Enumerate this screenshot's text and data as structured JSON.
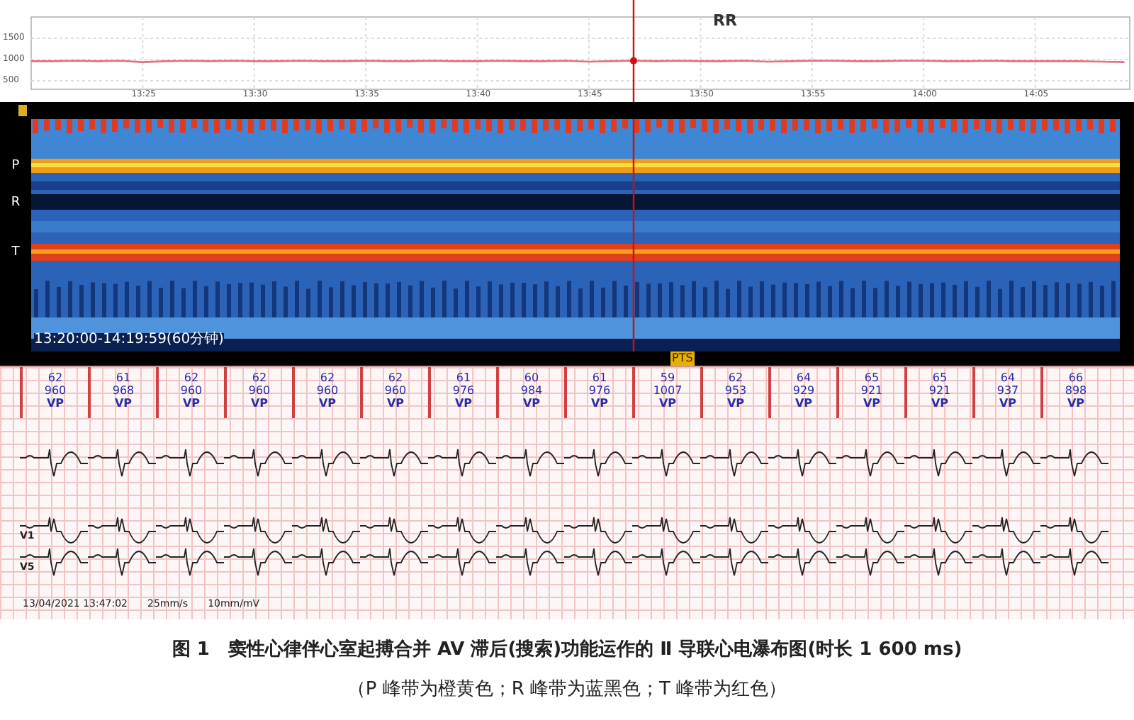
{
  "rr_chart": {
    "chart_data": {
      "type": "line",
      "title": "RR",
      "categories": [
        null,
        null,
        null,
        null,
        null,
        "13:25",
        null,
        null,
        null,
        null,
        "13:30",
        null,
        null,
        null,
        null,
        "13:35",
        null,
        null,
        null,
        null,
        "13:40",
        null,
        null,
        null,
        null,
        "13:45",
        null,
        null,
        null,
        null,
        "13:50",
        null,
        null,
        null,
        null,
        "13:55",
        null,
        null,
        null,
        null,
        "14:00",
        null,
        null,
        null,
        null,
        "14:05",
        null,
        null,
        null,
        null
      ],
      "series": [
        {
          "color": "#e0707a",
          "values": [
            960,
            960,
            970,
            960,
            970,
            940,
            960,
            970,
            960,
            970,
            960,
            960,
            970,
            960,
            960,
            970,
            960,
            960,
            970,
            960,
            960,
            970,
            960,
            960,
            970,
            950,
            960,
            970,
            960,
            970,
            960,
            960,
            970,
            950,
            960,
            970,
            970,
            960,
            960,
            970,
            970,
            960,
            960,
            970,
            960,
            960,
            960,
            960,
            950,
            940
          ]
        }
      ],
      "ylim": [
        300,
        2000
      ],
      "yticks": [
        500,
        1000,
        1500
      ],
      "grid": true
    }
  },
  "waterfall": {
    "band_labels": [
      "P",
      "R",
      "T"
    ],
    "time_range": "13:20:00-14:19:59(60分钟)",
    "footer_tag": "PTS"
  },
  "strip": {
    "beats": [
      {
        "rate": "62",
        "interval": "960",
        "type": "VP"
      },
      {
        "rate": "61",
        "interval": "968",
        "type": "VP"
      },
      {
        "rate": "62",
        "interval": "960",
        "type": "VP"
      },
      {
        "rate": "62",
        "interval": "960",
        "type": "VP"
      },
      {
        "rate": "62",
        "interval": "960",
        "type": "VP"
      },
      {
        "rate": "62",
        "interval": "960",
        "type": "VP"
      },
      {
        "rate": "61",
        "interval": "976",
        "type": "VP"
      },
      {
        "rate": "60",
        "interval": "984",
        "type": "VP"
      },
      {
        "rate": "61",
        "interval": "976",
        "type": "VP"
      },
      {
        "rate": "59",
        "interval": "1007",
        "type": "VP"
      },
      {
        "rate": "62",
        "interval": "953",
        "type": "VP"
      },
      {
        "rate": "64",
        "interval": "929",
        "type": "VP"
      },
      {
        "rate": "65",
        "interval": "921",
        "type": "VP"
      },
      {
        "rate": "65",
        "interval": "921",
        "type": "VP"
      },
      {
        "rate": "64",
        "interval": "937",
        "type": "VP"
      },
      {
        "rate": "66",
        "interval": "898",
        "type": "VP"
      }
    ],
    "leads": [
      {
        "kind": "upright"
      },
      {
        "kind": "inverted",
        "name": "V1"
      },
      {
        "kind": "upright",
        "name": "V5"
      }
    ],
    "timestamp": "13/04/2021 13:47:02",
    "speed": "25mm/s",
    "gain": "10mm/mV"
  },
  "caption": {
    "title": "图 1　窦性心律伴心室起搏合并 AV 滞后(搜索)功能运作的 Ⅱ 导联心电瀑布图(时长 1 600 ms)",
    "note": "（P 峰带为橙黄色；R 峰带为蓝黑色；T 峰带为红色）"
  }
}
